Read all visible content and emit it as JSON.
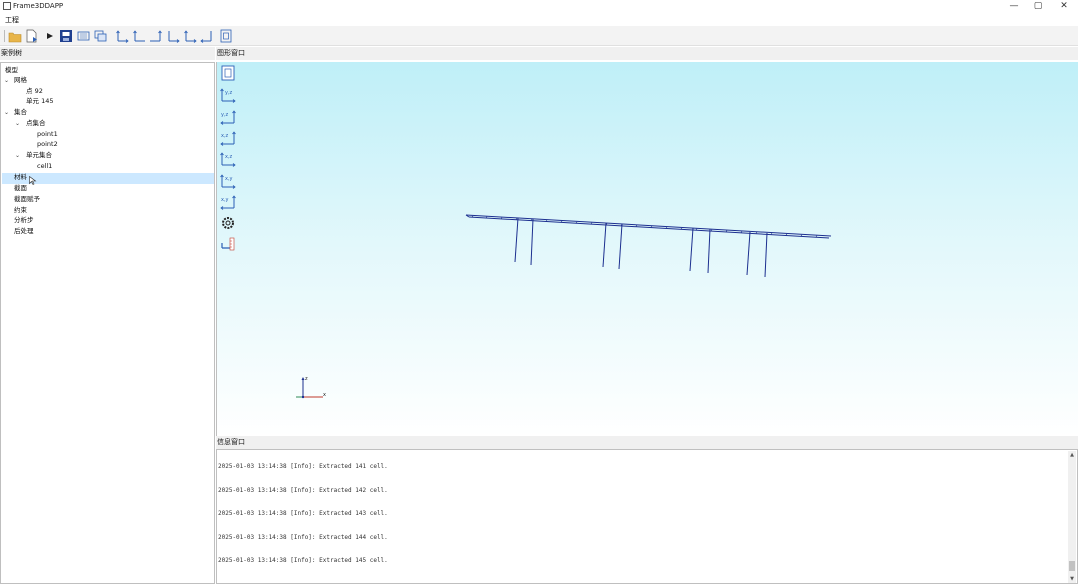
{
  "window": {
    "title": "Frame3DDAPP",
    "minimize": "—",
    "maximize": "▢",
    "close": "✕"
  },
  "menubar": {
    "items": [
      "工程"
    ]
  },
  "toolbar": {
    "icons": [
      "open-folder-icon",
      "new-file-icon",
      "run-icon",
      "save-icon",
      "view-mesh-icon",
      "view-layers-icon",
      "view-xy-icon",
      "view-yz-icon",
      "view-xz-icon",
      "view-zy-icon",
      "view-zx-icon",
      "view-yx-icon",
      "fit-view-icon"
    ]
  },
  "left_panel": {
    "header": "案例树",
    "tree": [
      {
        "label": "模型",
        "level": 0,
        "expanded": null
      },
      {
        "label": "网格",
        "level": 0,
        "expanded": true
      },
      {
        "label": "点 92",
        "level": 1,
        "expanded": null
      },
      {
        "label": "单元 145",
        "level": 1,
        "expanded": null
      },
      {
        "label": "集合",
        "level": 0,
        "expanded": true
      },
      {
        "label": "点集合",
        "level": 1,
        "expanded": true
      },
      {
        "label": "point1",
        "level": 2,
        "expanded": null
      },
      {
        "label": "point2",
        "level": 2,
        "expanded": null
      },
      {
        "label": "单元集合",
        "level": 1,
        "expanded": true
      },
      {
        "label": "cell1",
        "level": 2,
        "expanded": null
      },
      {
        "label": "材料",
        "level": 0,
        "expanded": null,
        "selected": true
      },
      {
        "label": "截面",
        "level": 0,
        "expanded": null
      },
      {
        "label": "截面赋予",
        "level": 0,
        "expanded": null
      },
      {
        "label": "约束",
        "level": 0,
        "expanded": null
      },
      {
        "label": "分析步",
        "level": 0,
        "expanded": null
      },
      {
        "label": "后处理",
        "level": 0,
        "expanded": null
      }
    ]
  },
  "view": {
    "header": "图形窗口",
    "tool_labels": {
      "yz": "y,z",
      "zy": "y,z",
      "xz": "x,z",
      "zx": "x,z",
      "xy": "x,y",
      "yx": "x,y"
    },
    "axis": {
      "z": "z",
      "x": "x"
    },
    "colors": {
      "structure": "#1c2f8f",
      "sky_top": "#bfeff8",
      "sky_bottom": "#ffffff"
    }
  },
  "output": {
    "header": "信息窗口",
    "lines": [
      "2025-01-03 13:14:38 [Info]: Extracted  141  cell.",
      "2025-01-03 13:14:38 [Info]: Extracted  142  cell.",
      "2025-01-03 13:14:38 [Info]: Extracted  143  cell.",
      "2025-01-03 13:14:38 [Info]: Extracted  144  cell.",
      "2025-01-03 13:14:38 [Info]: Extracted  145  cell."
    ]
  }
}
